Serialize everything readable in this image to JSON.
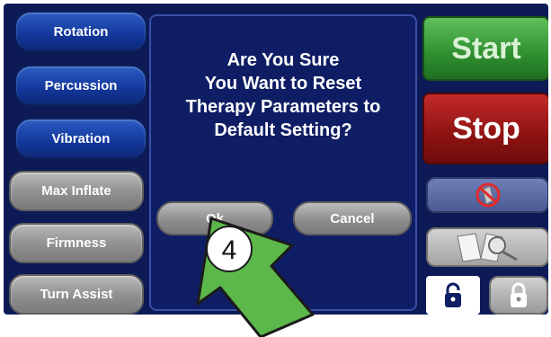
{
  "left_buttons": {
    "rotation": "Rotation",
    "percussion": "Percussion",
    "vibration": "Vibration",
    "max_inflate": "Max Inflate",
    "firmness": "Firmness",
    "turn_assist": "Turn Assist"
  },
  "dialog": {
    "message": "Are You Sure\nYou Want to Reset\nTherapy Parameters to\nDefault Setting?",
    "ok_label": "Ok",
    "cancel_label": "Cancel"
  },
  "right_buttons": {
    "start_label": "Start",
    "stop_label": "Stop",
    "silence_icon": "no-alarm-icon",
    "manual_icon": "manual-search-icon",
    "unlock_icon": "unlocked-padlock-icon",
    "lock_icon": "locked-padlock-icon"
  },
  "callout": {
    "step_number": "4",
    "arrow_color": "#5cb84a"
  }
}
